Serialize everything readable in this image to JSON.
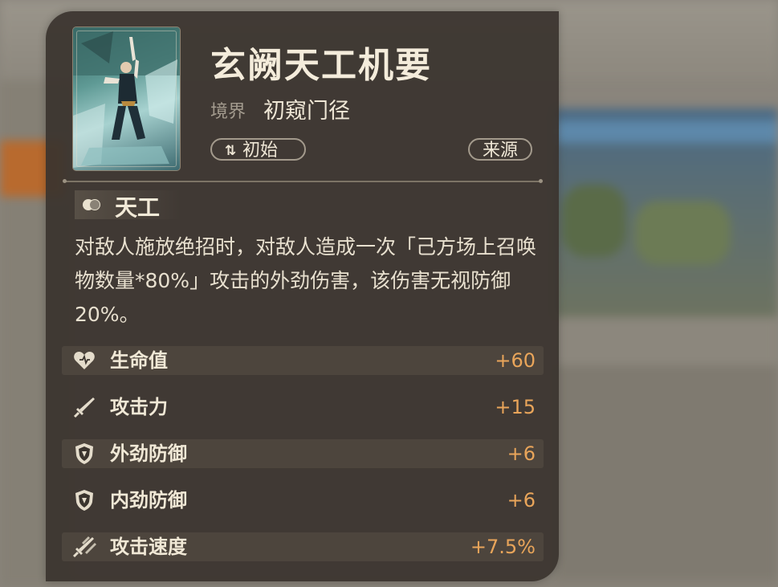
{
  "item": {
    "title": "玄阙天工机要",
    "realm_label": "境界",
    "realm_value": "初窥门径",
    "tag_initial": "初始",
    "source_button": "来源"
  },
  "skill": {
    "name": "天工",
    "description": "对敌人施放绝招时，对敌人造成一次「己方场上召唤物数量*80%」攻击的外劲伤害，该伤害无视防御20%。"
  },
  "stats": [
    {
      "label": "生命值",
      "value": "+60",
      "icon": "heart-icon"
    },
    {
      "label": "攻击力",
      "value": "+15",
      "icon": "sword-icon"
    },
    {
      "label": "外劲防御",
      "value": "+6",
      "icon": "shield-icon"
    },
    {
      "label": "内劲防御",
      "value": "+6",
      "icon": "shield-icon"
    },
    {
      "label": "攻击速度",
      "value": "+7.5%",
      "icon": "double-sword-icon"
    }
  ],
  "colors": {
    "panel": "#3a342e",
    "stat_value": "#e9a55a",
    "text_primary": "#f4ecdb",
    "text_muted": "#a39b8e"
  }
}
